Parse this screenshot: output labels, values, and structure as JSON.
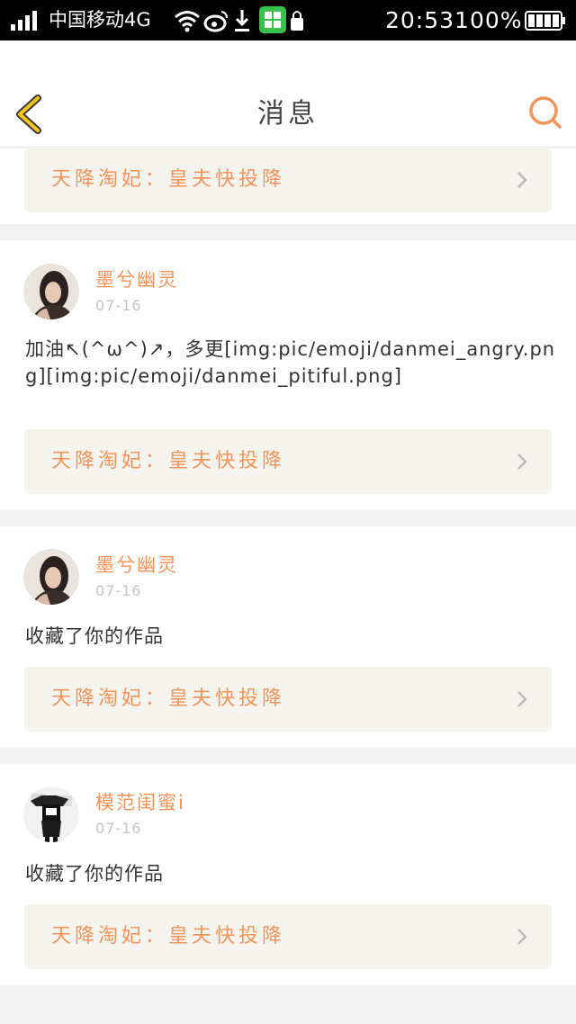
{
  "status_bar": {
    "carrier": "中国移动4G",
    "time": "20:53",
    "battery": "100%",
    "icons": [
      "signal-icon",
      "wifi-icon",
      "weibo-icon",
      "download-icon",
      "app-icon",
      "lock-icon",
      "battery-icon"
    ]
  },
  "header": {
    "title": "消息",
    "back_icon": "chevron-left-icon",
    "search_icon": "search-icon"
  },
  "colors": {
    "accent": "#f2945b",
    "back": "#f0c51c",
    "card_bg": "#f4f3ed"
  },
  "items": [
    {
      "work_title": "天降淘妃：皇夫快投降"
    },
    {
      "user": "墨兮幽灵",
      "date": "07-16",
      "message": "加油↖(^ω^)↗，多更[img:pic/emoji/danmei_angry.png][img:pic/emoji/danmei_pitiful.png]",
      "work_title": "天降淘妃：皇夫快投降"
    },
    {
      "user": "墨兮幽灵",
      "date": "07-16",
      "message": "收藏了你的作品",
      "work_title": "天降淘妃：皇夫快投降"
    },
    {
      "user": "模范闺蜜i",
      "date": "07-16",
      "message": "收藏了你的作品",
      "work_title": "天降淘妃：皇夫快投降"
    }
  ]
}
